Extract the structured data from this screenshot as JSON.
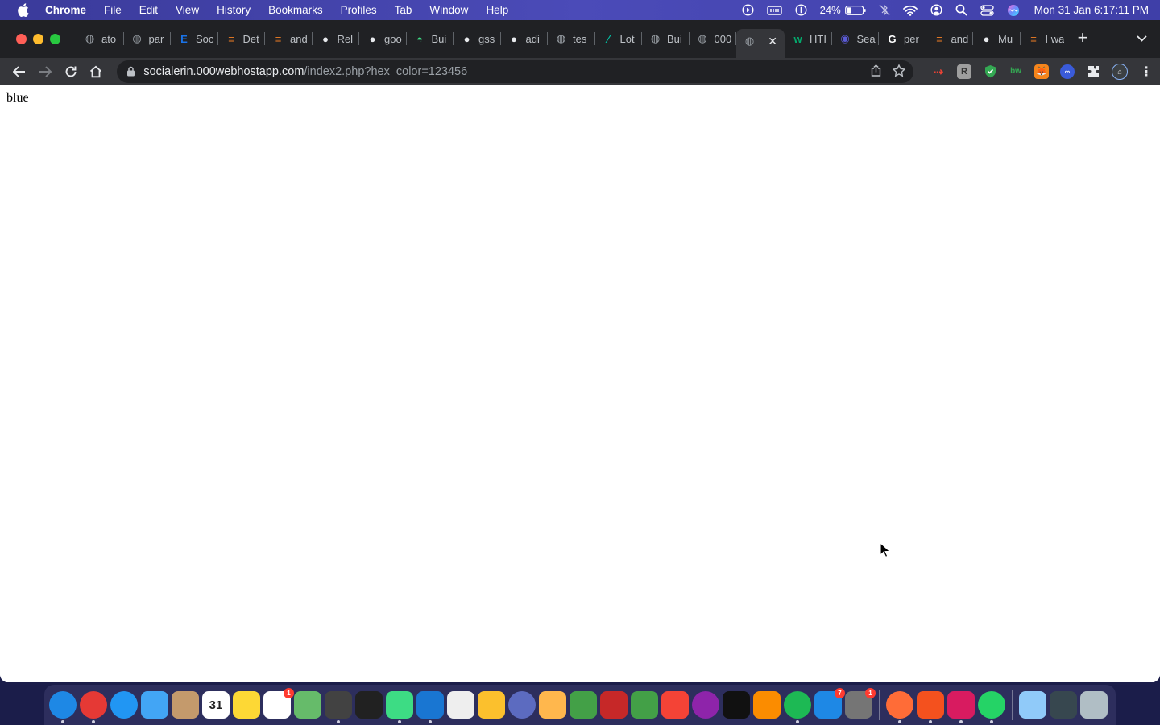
{
  "menubar": {
    "app_name": "Chrome",
    "items": [
      "File",
      "Edit",
      "View",
      "History",
      "Bookmarks",
      "Profiles",
      "Tab",
      "Window",
      "Help"
    ],
    "battery": "24%",
    "clock": "Mon 31 Jan  6:17:11 PM"
  },
  "tabs": [
    {
      "title": "ato",
      "icon": "globe-icon",
      "color": "#9aa0a6"
    },
    {
      "title": "par",
      "icon": "globe-icon",
      "color": "#9aa0a6"
    },
    {
      "title": "Soc",
      "icon": "e-icon",
      "color": "#1a73e8"
    },
    {
      "title": "Det",
      "icon": "stackoverflow-icon",
      "color": "#f48024"
    },
    {
      "title": "and",
      "icon": "stackoverflow-icon",
      "color": "#f48024"
    },
    {
      "title": "Rel",
      "icon": "github-icon",
      "color": "#e8eaed"
    },
    {
      "title": "goo",
      "icon": "github-icon",
      "color": "#e8eaed"
    },
    {
      "title": "Bui",
      "icon": "android-icon",
      "color": "#3ddc84"
    },
    {
      "title": "gss",
      "icon": "github-icon",
      "color": "#e8eaed"
    },
    {
      "title": "adi",
      "icon": "github-icon",
      "color": "#e8eaed"
    },
    {
      "title": "tes",
      "icon": "globe-icon",
      "color": "#9aa0a6"
    },
    {
      "title": "Lot",
      "icon": "lottie-icon",
      "color": "#00c1a4"
    },
    {
      "title": "Bui",
      "icon": "globe-icon",
      "color": "#9aa0a6"
    },
    {
      "title": "000",
      "icon": "globe-icon",
      "color": "#9aa0a6"
    },
    {
      "title": "",
      "icon": "globe-icon",
      "color": "#9aa0a6",
      "active": true
    },
    {
      "title": "HTI",
      "icon": "w3-icon",
      "color": "#04aa6d"
    },
    {
      "title": "Sea",
      "icon": "search-engine-icon",
      "color": "#5b5bd6"
    },
    {
      "title": "per",
      "icon": "google-icon",
      "color": "#ffffff"
    },
    {
      "title": "and",
      "icon": "stackoverflow-icon",
      "color": "#f48024"
    },
    {
      "title": "Mu",
      "icon": "github-icon",
      "color": "#e8eaed"
    },
    {
      "title": "I wa",
      "icon": "stackoverflow-icon",
      "color": "#f48024"
    }
  ],
  "address": {
    "host": "socialerin.000webhostapp.com",
    "path": "/index2.php?hex_color=123456"
  },
  "page": {
    "text": "blue"
  },
  "dock": {
    "apps": [
      {
        "name": "finder",
        "color": "#1e88e5",
        "running": true
      },
      {
        "name": "chrome",
        "color": "#e53935",
        "running": true
      },
      {
        "name": "safari",
        "color": "#2196f3",
        "running": false
      },
      {
        "name": "mail",
        "color": "#42a5f5",
        "running": false
      },
      {
        "name": "contacts",
        "color": "#c49a6c",
        "running": false
      },
      {
        "name": "calendar",
        "color": "#ffffff",
        "running": false,
        "label": "31"
      },
      {
        "name": "notes",
        "color": "#fdd835",
        "running": false
      },
      {
        "name": "reminders",
        "color": "#ffffff",
        "running": false,
        "badge": "1"
      },
      {
        "name": "maps",
        "color": "#66bb6a",
        "running": false
      },
      {
        "name": "calculator",
        "color": "#424242",
        "running": true
      },
      {
        "name": "terminal",
        "color": "#212121",
        "running": false
      },
      {
        "name": "android-studio",
        "color": "#3ddc84",
        "running": true
      },
      {
        "name": "vscode",
        "color": "#1976d2",
        "running": true
      },
      {
        "name": "script-editor",
        "color": "#eeeeee",
        "running": false
      },
      {
        "name": "sketch",
        "color": "#fbc02d",
        "running": false
      },
      {
        "name": "siri",
        "color": "#5c6bc0",
        "running": false
      },
      {
        "name": "photos",
        "color": "#ffb74d",
        "running": false
      },
      {
        "name": "messages",
        "color": "#43a047",
        "running": false
      },
      {
        "name": "photo-booth",
        "color": "#c62828",
        "running": false
      },
      {
        "name": "facetime",
        "color": "#43a047",
        "running": false
      },
      {
        "name": "music",
        "color": "#f44336",
        "running": false
      },
      {
        "name": "podcasts",
        "color": "#8e24aa",
        "running": false
      },
      {
        "name": "apple-tv",
        "color": "#111111",
        "running": false
      },
      {
        "name": "books",
        "color": "#fb8c00",
        "running": false
      },
      {
        "name": "spotify",
        "color": "#1db954",
        "running": true
      },
      {
        "name": "app-store",
        "color": "#1e88e5",
        "running": false,
        "badge": "7"
      },
      {
        "name": "system-preferences",
        "color": "#757575",
        "running": false,
        "badge": "1"
      },
      {
        "name": "postman",
        "color": "#ff6c37",
        "running": true
      },
      {
        "name": "git-client",
        "color": "#f4511e",
        "running": true
      },
      {
        "name": "azure-data",
        "color": "#d81b60",
        "running": true
      },
      {
        "name": "whatsapp",
        "color": "#25d366",
        "running": true
      },
      {
        "name": "downloads-folder",
        "color": "#90caf9",
        "running": false
      },
      {
        "name": "screen-recording",
        "color": "#37474f",
        "running": false
      },
      {
        "name": "trash",
        "color": "#b0bec5",
        "running": false
      }
    ]
  }
}
